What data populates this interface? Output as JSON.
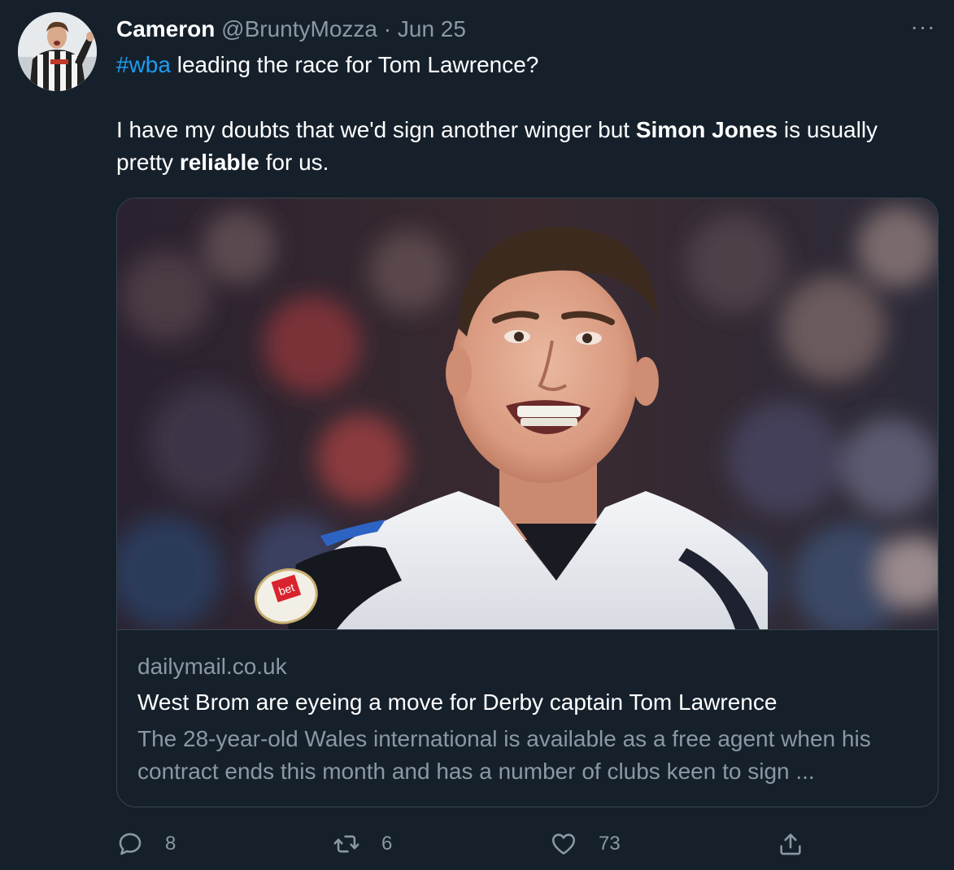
{
  "tweet": {
    "author": {
      "name": "Cameron",
      "handle": "@BruntyMozza",
      "separator": "·",
      "date": "Jun 25"
    },
    "more_menu": "···",
    "hashtag": "#wba",
    "line1_rest": " leading the race for Tom Lawrence?",
    "para2": {
      "t1": "I have my doubts that we'd sign another winger but ",
      "b1": "Simon Jones",
      "t2": " is usually pretty ",
      "b2": "reliable",
      "t3": " for us."
    }
  },
  "card": {
    "domain": "dailymail.co.uk",
    "title": "West Brom are eyeing a move for Derby captain Tom Lawrence",
    "description": "The 28-year-old Wales international is available as a free agent when his contract ends this month and has a number of clubs keen to sign ...",
    "image_badge": "bet"
  },
  "actions": {
    "reply_count": "8",
    "retweet_count": "6",
    "like_count": "73"
  },
  "icons": {
    "reply": "reply-icon",
    "retweet": "retweet-icon",
    "like": "heart-icon",
    "share": "share-icon",
    "more": "more-icon"
  },
  "colors": {
    "background": "#15202b",
    "text": "#ffffff",
    "secondary_text": "#8b98a5",
    "link": "#1d9bf0",
    "border": "#38444d"
  }
}
